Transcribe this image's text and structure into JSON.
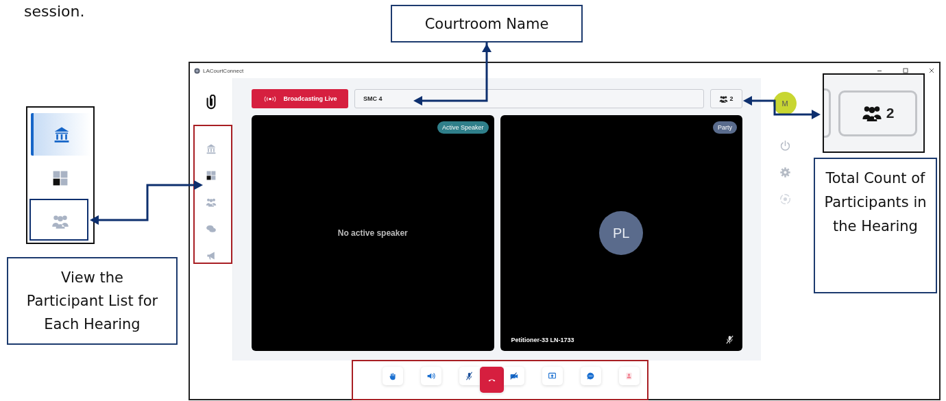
{
  "intro_text": "session.",
  "callouts": [
    {
      "kind": "courtroom",
      "text": "Courtroom Name"
    },
    {
      "kind": "participants",
      "text": "View the Participant List for Each Hearing"
    },
    {
      "kind": "count",
      "text": "Total Count of Participants in the Hearing"
    }
  ],
  "app": {
    "title": "LACourtConnect",
    "status_badge": "Broadcasting Live",
    "courtroom_name": "SMC 4",
    "participant_count": "2",
    "user_initial": "M",
    "nav": [
      {
        "kind": "courthouse"
      },
      {
        "kind": "layout"
      },
      {
        "kind": "participants"
      },
      {
        "kind": "chat"
      },
      {
        "kind": "announce"
      }
    ],
    "side_actions": [
      {
        "kind": "power"
      },
      {
        "kind": "settings"
      },
      {
        "kind": "target"
      }
    ],
    "tiles": [
      {
        "kind": "speaker",
        "badge": "Active Speaker",
        "message": "No active speaker"
      },
      {
        "kind": "participant",
        "badge": "Party",
        "initials": "PL",
        "name": "Petitioner-33 LN-1733",
        "muted": true
      }
    ],
    "controls": [
      {
        "kind": "hand"
      },
      {
        "kind": "speaker"
      },
      {
        "kind": "mic-off"
      },
      {
        "kind": "hang-up"
      },
      {
        "kind": "camera-off"
      },
      {
        "kind": "share"
      },
      {
        "kind": "chat"
      },
      {
        "kind": "record"
      }
    ]
  },
  "nav_inset": {
    "items": [
      {
        "kind": "courthouse",
        "selected": true
      },
      {
        "kind": "layout",
        "selected": false
      },
      {
        "kind": "participants",
        "selected": false
      }
    ]
  },
  "count_inset": {
    "participant_count": "2"
  }
}
